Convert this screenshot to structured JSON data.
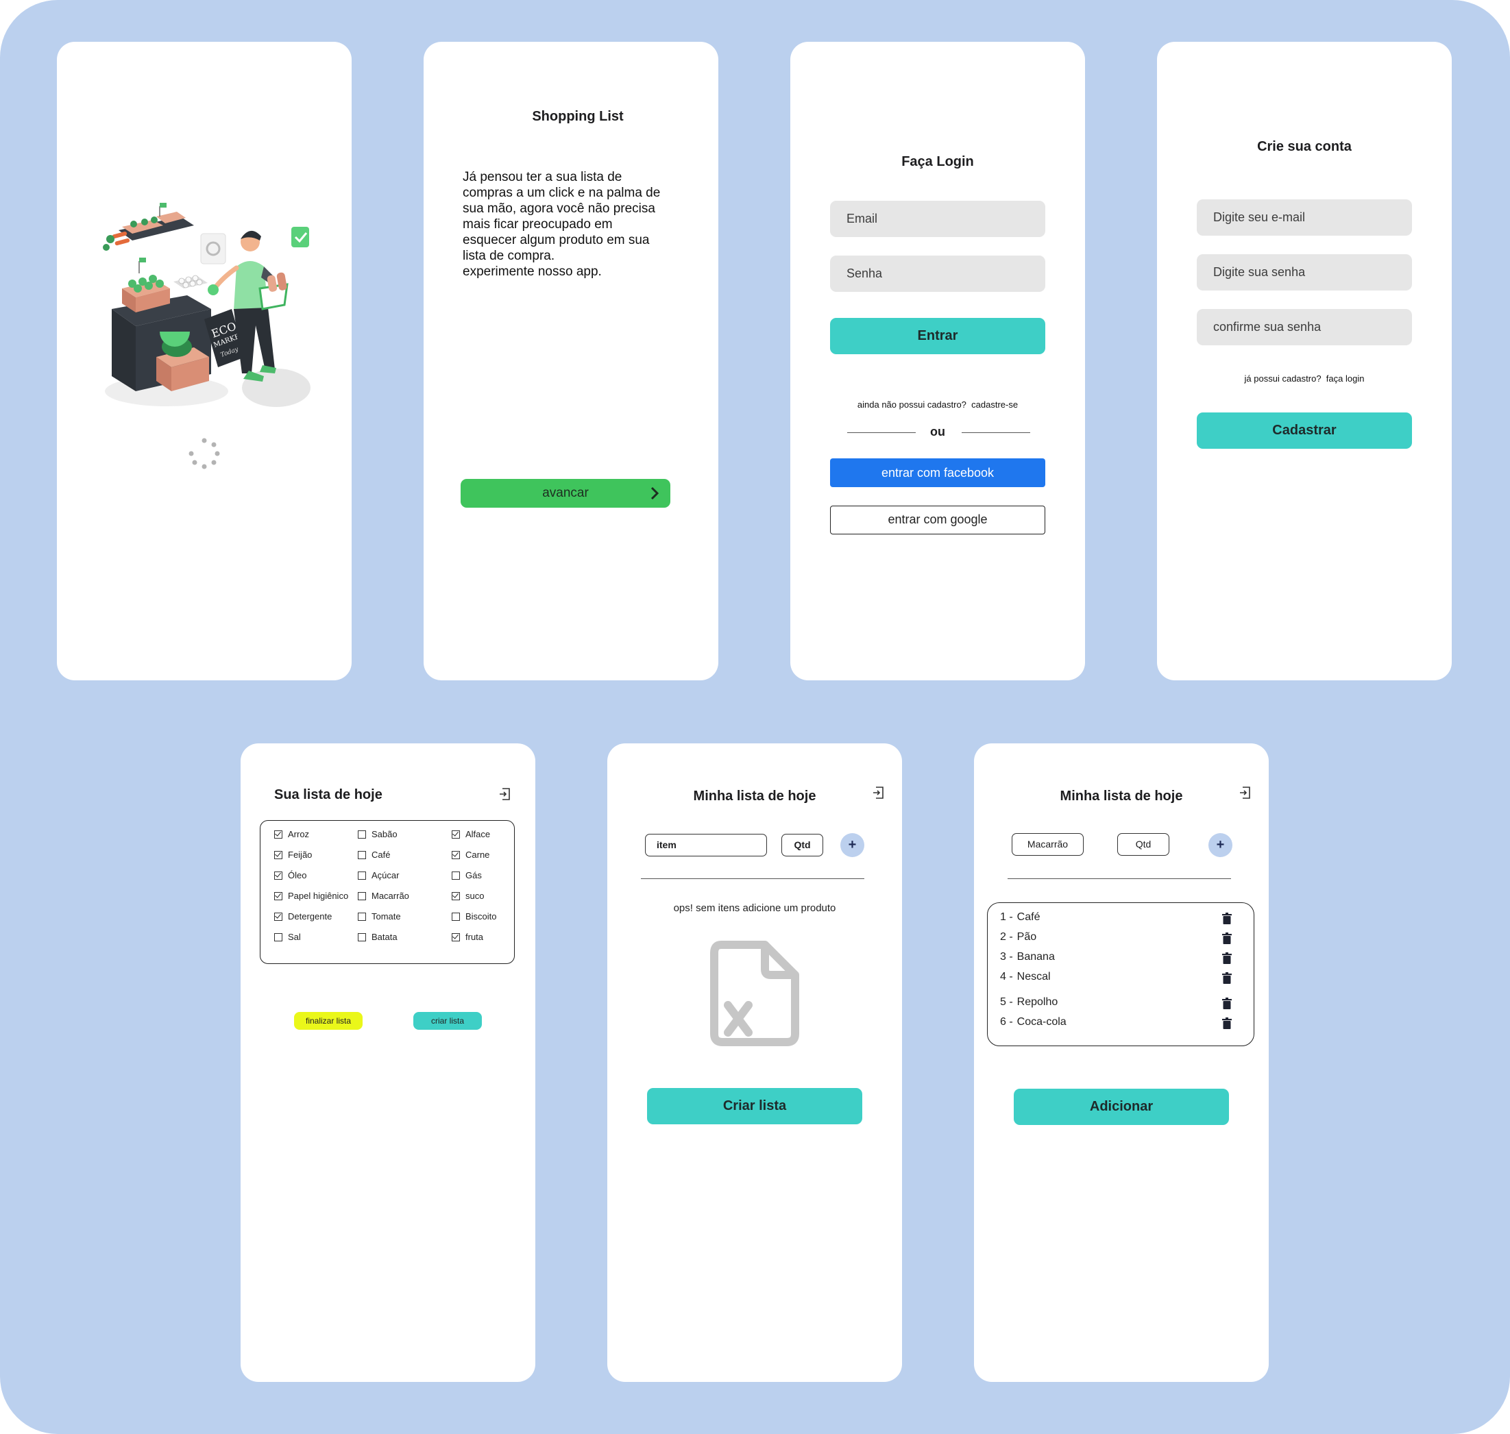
{
  "colors": {
    "background": "#bbd0ee",
    "teal_button": "#3ecfc6",
    "green_button": "#3fc45c",
    "facebook_blue": "#1f77ee",
    "yellow_button": "#eaf71a"
  },
  "splash": {
    "illustration_text": {
      "line1": "ECO",
      "line2": "MARKET",
      "line3": "Today"
    }
  },
  "intro": {
    "title": "Shopping List",
    "body_lines": [
      "Já pensou ter a sua lista de",
      "compras a um click e na palma de",
      "sua mão, agora você não precisa",
      "mais ficar preocupado em",
      "esquecer algum produto em sua",
      "lista de compra.",
      "experimente nosso app."
    ],
    "button_label": "avancar"
  },
  "login": {
    "title": "Faça Login",
    "email_placeholder": "Email",
    "password_placeholder": "Senha",
    "submit_label": "Entrar",
    "no_account_text": "ainda não possui cadastro?",
    "signup_link": "cadastre-se",
    "divider_text": "ou",
    "facebook_label": "entrar com facebook",
    "google_label": "entrar com google"
  },
  "register": {
    "title": "Crie sua conta",
    "email_placeholder": "Digite seu e-mail",
    "password_placeholder": "Digite sua senha",
    "confirm_placeholder": "confirme sua senha",
    "has_account_text": "já possui cadastro?",
    "login_link": "faça login",
    "submit_label": "Cadastrar"
  },
  "today_list": {
    "title": "Sua lista de hoje",
    "columns": [
      [
        {
          "label": "Arroz",
          "checked": true
        },
        {
          "label": "Feijão",
          "checked": true
        },
        {
          "label": "Óleo",
          "checked": true
        },
        {
          "label": "Papel higiênico",
          "checked": true
        },
        {
          "label": "Detergente",
          "checked": true
        },
        {
          "label": "Sal",
          "checked": false
        }
      ],
      [
        {
          "label": "Sabão",
          "checked": false
        },
        {
          "label": "Café",
          "checked": false
        },
        {
          "label": "Açúcar",
          "checked": false
        },
        {
          "label": "Macarrão",
          "checked": false
        },
        {
          "label": "Tomate",
          "checked": false
        },
        {
          "label": "Batata",
          "checked": false
        }
      ],
      [
        {
          "label": "Alface",
          "checked": true
        },
        {
          "label": "Carne",
          "checked": true
        },
        {
          "label": "Gás",
          "checked": false
        },
        {
          "label": "suco",
          "checked": true
        },
        {
          "label": "Biscoito",
          "checked": false
        },
        {
          "label": "fruta",
          "checked": true
        }
      ]
    ],
    "finish_label": "finalizar lista",
    "create_label": "criar lista"
  },
  "empty_list": {
    "title": "Minha lista de hoje",
    "item_value": "item",
    "qty_value": "Qtd",
    "add_symbol": "+",
    "empty_message": "ops! sem itens adicione um produto",
    "button_label": "Criar lista"
  },
  "filled_list": {
    "title": "Minha lista de hoje",
    "item_value": "Macarrão",
    "qty_value": "Qtd",
    "add_symbol": "+",
    "items": [
      {
        "num": "1 -",
        "name": "Café"
      },
      {
        "num": "2 -",
        "name": "Pão"
      },
      {
        "num": "3 -",
        "name": "Banana"
      },
      {
        "num": "4 -",
        "name": "Nescal"
      },
      {
        "num": "5 -",
        "name": "Repolho"
      },
      {
        "num": "6 -",
        "name": "Coca-cola"
      }
    ],
    "button_label": "Adicionar"
  }
}
